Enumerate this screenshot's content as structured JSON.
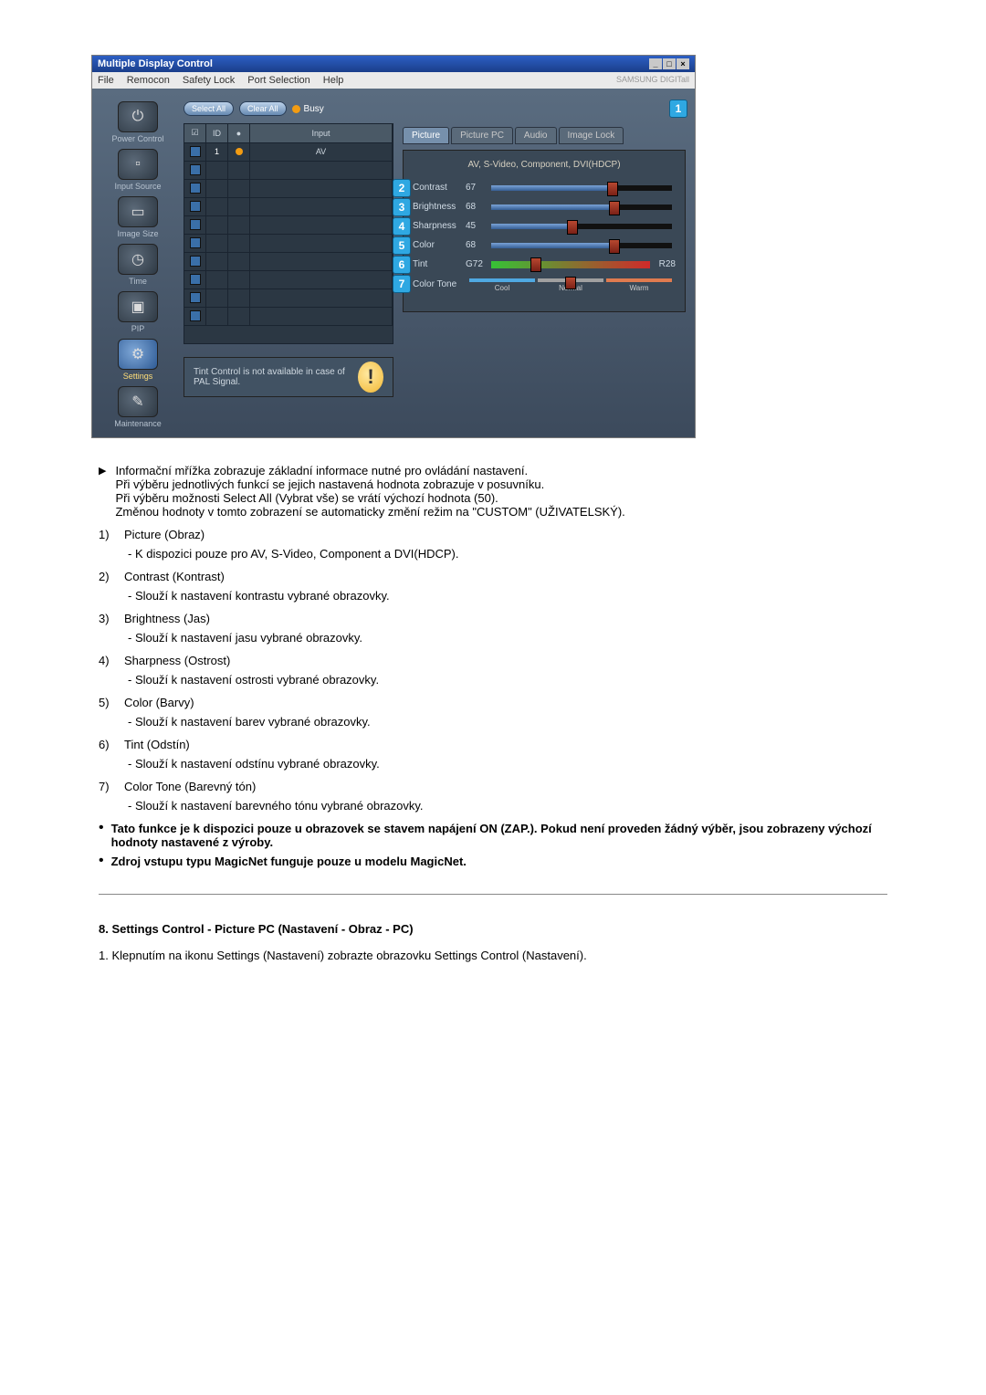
{
  "window": {
    "title": "Multiple Display Control",
    "menus": [
      "File",
      "Remocon",
      "Safety Lock",
      "Port Selection",
      "Help"
    ],
    "brand": "SAMSUNG DIGITall"
  },
  "sidebar": {
    "items": [
      {
        "label": "Power Control",
        "glyph": "⏻"
      },
      {
        "label": "Input Source",
        "glyph": "▫"
      },
      {
        "label": "Image Size",
        "glyph": "▭"
      },
      {
        "label": "Time",
        "glyph": "◷"
      },
      {
        "label": "PIP",
        "glyph": "▣"
      },
      {
        "label": "Settings",
        "glyph": "⚙"
      },
      {
        "label": "Maintenance",
        "glyph": "✎"
      }
    ]
  },
  "toolbar": {
    "select_all": "Select All",
    "clear_all": "Clear All",
    "busy": "Busy"
  },
  "grid": {
    "headers": {
      "chk": "☑",
      "id": "ID",
      "status": "",
      "input": "Input"
    },
    "rows": [
      {
        "id": "1",
        "input": "AV",
        "on": true
      }
    ],
    "empty_rows": 9
  },
  "tabs": [
    "Picture",
    "Picture PC",
    "Audio",
    "Image Lock"
  ],
  "panel": {
    "title": "AV, S-Video, Component, DVI(HDCP)",
    "contrast": {
      "label": "Contrast",
      "val": "67",
      "pct": 67
    },
    "brightness": {
      "label": "Brightness",
      "val": "68",
      "pct": 68
    },
    "sharpness": {
      "label": "Sharpness",
      "val": "45",
      "pct": 45
    },
    "color": {
      "label": "Color",
      "val": "68",
      "pct": 68
    },
    "tint": {
      "label": "Tint",
      "left": "G72",
      "right": "R28",
      "pct": 28
    },
    "tone": {
      "label": "Color Tone",
      "cool": "Cool",
      "normal": "Normal",
      "warm": "Warm"
    }
  },
  "note": "Tint Control is not available in case of PAL Signal.",
  "doc": {
    "arrow": [
      "Informační mřížka zobrazuje základní informace nutné pro ovládání nastavení.",
      "Při výběru jednotlivých funkcí se jejich nastavená hodnota zobrazuje v posuvníku.",
      "Při výběru možnosti Select All (Vybrat vše) se vrátí výchozí hodnota (50).",
      "Změnou hodnoty v tomto zobrazení se automaticky změní režim na \"CUSTOM\" (UŽIVATELSKÝ)."
    ],
    "items": [
      {
        "n": "1)",
        "t": "Picture (Obraz)",
        "s": "- K dispozici pouze pro AV, S-Video, Component a DVI(HDCP)."
      },
      {
        "n": "2)",
        "t": "Contrast (Kontrast)",
        "s": "- Slouží k nastavení kontrastu vybrané obrazovky."
      },
      {
        "n": "3)",
        "t": "Brightness (Jas)",
        "s": "- Slouží k nastavení jasu vybrané obrazovky."
      },
      {
        "n": "4)",
        "t": "Sharpness (Ostrost)",
        "s": "- Slouží k nastavení ostrosti vybrané obrazovky."
      },
      {
        "n": "5)",
        "t": "Color (Barvy)",
        "s": "- Slouží k nastavení barev vybrané obrazovky."
      },
      {
        "n": "6)",
        "t": "Tint (Odstín)",
        "s": "- Slouží k nastavení odstínu vybrané obrazovky."
      },
      {
        "n": "7)",
        "t": "Color Tone (Barevný tón)",
        "s": "- Slouží k nastavení barevného tónu vybrané obrazovky."
      }
    ],
    "bullets": [
      "Tato funkce je k dispozici pouze u obrazovek se stavem napájení ON (ZAP.). Pokud není proveden žádný výběr, jsou zobrazeny výchozí hodnoty nastavené z výroby.",
      "Zdroj vstupu typu MagicNet funguje pouze u modelu MagicNet."
    ],
    "heading": "8. Settings Control - Picture PC (Nastavení - Obraz - PC)",
    "step": "1. Klepnutím na ikonu Settings (Nastavení) zobrazte obrazovku Settings Control (Nastavení)."
  }
}
